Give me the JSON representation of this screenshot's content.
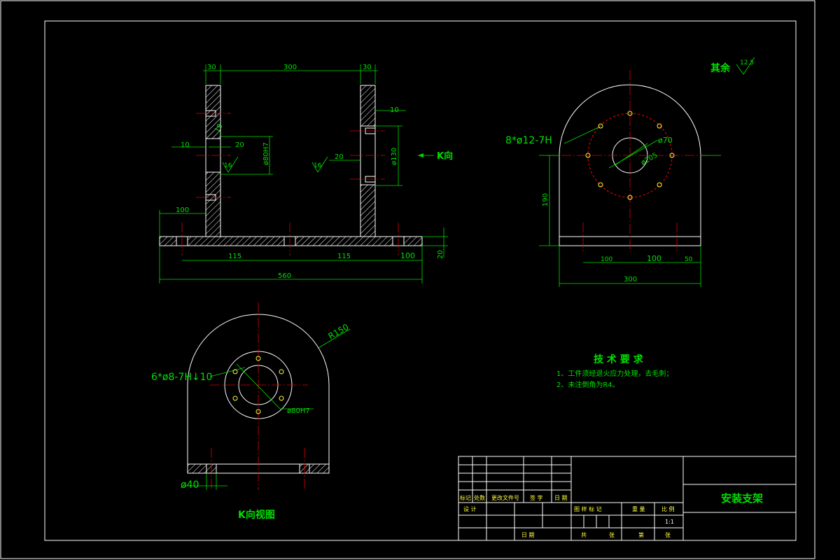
{
  "front_view": {
    "dim_30_left": "30",
    "dim_300": "300",
    "dim_30_right": "30",
    "dim_10_right": "10",
    "dim_10_left": "10",
    "dim_20_left": "20",
    "dim_20_right": "20",
    "dim_19": "19",
    "dim_phi80": "ø80H7",
    "dim_phi130": "ø130",
    "rough_16_left": "16",
    "rough_16_right": "16",
    "dim_100_top": "100",
    "dim_115_a": "115",
    "dim_115_b": "115",
    "dim_100_base": "100",
    "dim_20_base": "20",
    "dim_560": "560",
    "k_direction": "K向"
  },
  "side_view": {
    "holes_label": "8*ø12-7H",
    "dim_phi70": "ø70",
    "dim_phi205": "ø205",
    "dim_190": "190",
    "dim_100_a": "100",
    "dim_100_b": "100",
    "dim_50": "50",
    "dim_300": "300"
  },
  "roughness_note": {
    "label": "其余",
    "value": "12.5"
  },
  "k_view": {
    "r150": "R150",
    "holes_label": "6*ø8-7H↓10",
    "phi80": "ø80H7",
    "phi40": "ø40",
    "title": "K向视图"
  },
  "tech_requirements": {
    "title": "技 术 要 求",
    "items": [
      "1、工件须经退火应力处理，去毛刺；",
      "2、未注倒角为R4。"
    ]
  },
  "title_block": {
    "part_name": "安装支架",
    "scale": "1:1",
    "r1": [
      "标记",
      "处数",
      "更改文件号",
      "签 字",
      "日 期"
    ],
    "r2": "设 计",
    "r3": [
      "图 样 标 记",
      "重 量",
      "比 例"
    ],
    "r4": [
      "共",
      "张",
      "第",
      "张"
    ],
    "r5": "日 期"
  }
}
